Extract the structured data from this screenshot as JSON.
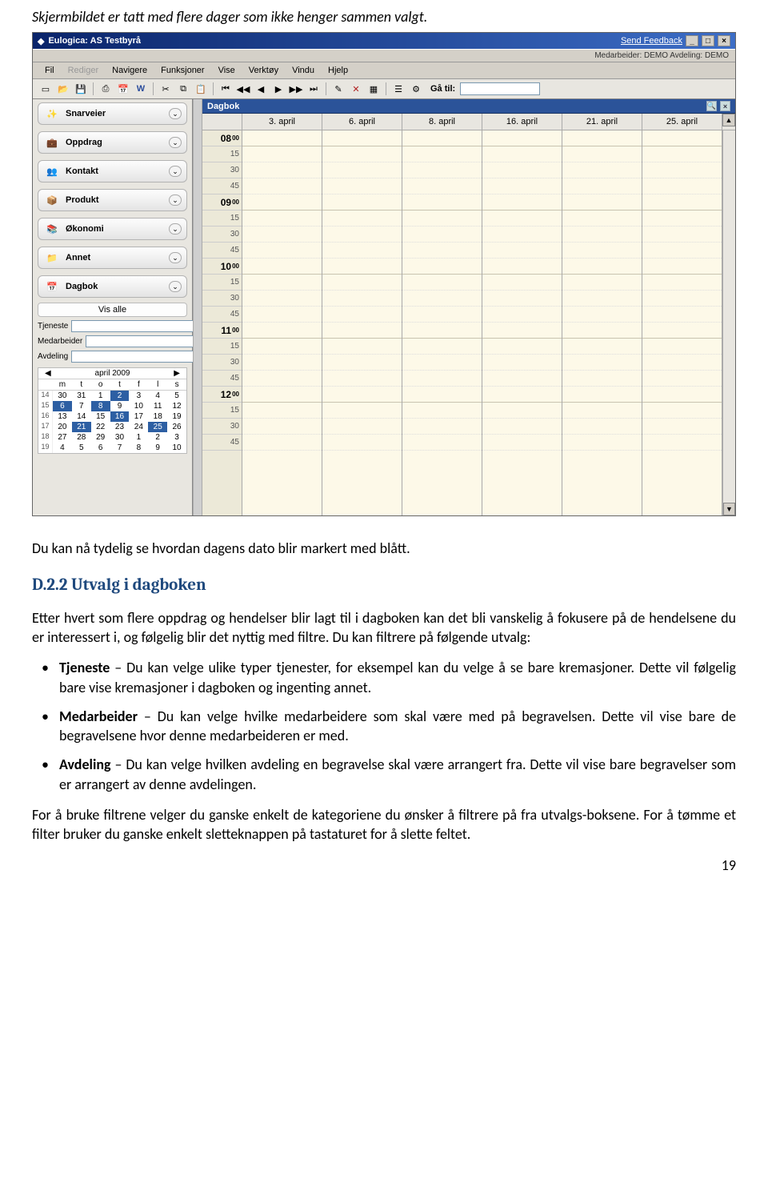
{
  "doc": {
    "caption": "Skjermbildet er tatt med flere dager som ikke henger sammen valgt.",
    "p1": "Du kan nå tydelig se hvordan dagens dato blir markert med blått.",
    "section_head": "D.2.2 Utvalg i dagboken",
    "p2": "Etter hvert som flere oppdrag og hendelser blir lagt til i dagboken kan det bli vanskelig å fokusere på de hendelsene du er interessert i, og følgelig blir det nyttig med filtre.  Du kan filtrere på følgende utvalg:",
    "b1a": "Tjeneste",
    "b1b": " – Du kan velge ulike typer tjenester, for eksempel kan du velge å se bare kremasjoner.  Dette vil følgelig bare vise kremasjoner i dagboken og ingenting annet.",
    "b2a": "Medarbeider",
    "b2b": " – Du kan velge hvilke medarbeidere som skal være med på begravelsen.  Dette vil vise bare de begravelsene hvor denne medarbeideren er med.",
    "b3a": "Avdeling",
    "b3b": " – Du kan velge hvilken avdeling en begravelse skal være arrangert fra.  Dette vil vise bare begravelser som er arrangert av denne avdelingen.",
    "p3": "For å bruke filtrene velger du ganske enkelt de kategoriene du ønsker å filtrere på fra utvalgs-boksene.  For å tømme et filter bruker du ganske enkelt sletteknappen på tastaturet for å slette feltet.",
    "pagenum": "19"
  },
  "app": {
    "title": "Eulogica: AS Testbyrå",
    "feedback": "Send Feedback",
    "status": "Medarbeider: DEMO  Avdeling: DEMO",
    "menu": [
      "Fil",
      "Rediger",
      "Navigere",
      "Funksjoner",
      "Vise",
      "Verktøy",
      "Vindu",
      "Hjelp"
    ],
    "goto_label": "Gå til:",
    "sidebar": {
      "sections": [
        "Snarveier",
        "Oppdrag",
        "Kontakt",
        "Produkt",
        "Økonomi",
        "Annet",
        "Dagbok"
      ],
      "vis_alle": "Vis alle",
      "filters": [
        "Tjeneste",
        "Medarbeider",
        "Avdeling"
      ],
      "cal_month": "april 2009",
      "cal_dow": [
        "m",
        "t",
        "o",
        "t",
        "f",
        "l",
        "s"
      ],
      "cal_weeks": [
        {
          "wk": "14",
          "days": [
            "30",
            "31",
            "1",
            "2",
            "3",
            "4",
            "5"
          ],
          "sel": [
            3
          ]
        },
        {
          "wk": "15",
          "days": [
            "6",
            "7",
            "8",
            "9",
            "10",
            "11",
            "12"
          ],
          "sel": [
            0,
            2
          ]
        },
        {
          "wk": "16",
          "days": [
            "13",
            "14",
            "15",
            "16",
            "17",
            "18",
            "19"
          ],
          "sel": [
            3
          ]
        },
        {
          "wk": "17",
          "days": [
            "20",
            "21",
            "22",
            "23",
            "24",
            "25",
            "26"
          ],
          "sel": [
            1,
            5
          ]
        },
        {
          "wk": "18",
          "days": [
            "27",
            "28",
            "29",
            "30",
            "1",
            "2",
            "3"
          ],
          "sel": []
        },
        {
          "wk": "19",
          "days": [
            "4",
            "5",
            "6",
            "7",
            "8",
            "9",
            "10"
          ],
          "sel": []
        }
      ]
    },
    "calpane": {
      "title": "Dagbok",
      "dates": [
        "3. april",
        "6. april",
        "8. april",
        "16. april",
        "21. april",
        "25. april"
      ],
      "hours": [
        "08",
        "09",
        "10",
        "11",
        "12"
      ],
      "subs": [
        "15",
        "30",
        "45"
      ]
    }
  }
}
